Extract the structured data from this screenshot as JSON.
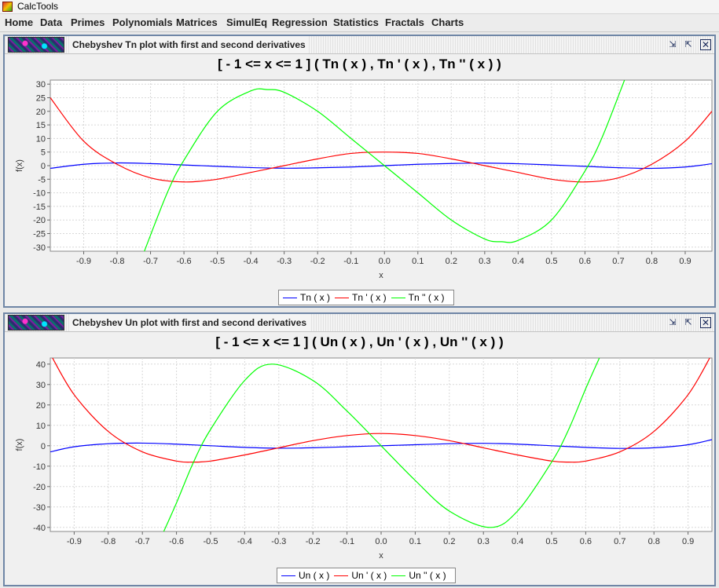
{
  "app": {
    "title": "CalcTools"
  },
  "menu": [
    "Home",
    "Data",
    "Primes",
    "Polynomials",
    "Matrices",
    "SimulEq",
    "Regression",
    "Statistics",
    "Fractals",
    "Charts"
  ],
  "chart_data": [
    {
      "type": "line",
      "window_title": "Chebyshev Tn plot with first and second derivatives",
      "title": "[ - 1 <= x <= 1  ]  ( Tn ( x ) , Tn ' ( x ) , Tn '' ( x ) )",
      "xlabel": "x",
      "ylabel": "f(x)",
      "xlim": [
        -1.0,
        0.98
      ],
      "ylim": [
        -31.5,
        31.5
      ],
      "x_ticks": [
        -0.9,
        -0.8,
        -0.7,
        -0.6,
        -0.5,
        -0.4,
        -0.3,
        -0.2,
        -0.1,
        0.0,
        0.1,
        0.2,
        0.3,
        0.4,
        0.5,
        0.6,
        0.7,
        0.8,
        0.9
      ],
      "y_ticks": [
        30,
        25,
        20,
        15,
        10,
        5,
        0,
        -5,
        -10,
        -15,
        -20,
        -25,
        -30
      ],
      "grid": true,
      "legend_position": "bottom",
      "series": [
        {
          "name": "Tn ( x )",
          "color": "#0000ff",
          "x": [
            -1.0,
            -0.9,
            -0.8,
            -0.7,
            -0.6,
            -0.5,
            -0.4,
            -0.3,
            -0.2,
            -0.1,
            0.0,
            0.1,
            0.2,
            0.3,
            0.4,
            0.5,
            0.6,
            0.7,
            0.8,
            0.9,
            0.98
          ],
          "y": [
            -1.0,
            0.5,
            1.0,
            0.75,
            0.25,
            -0.25,
            -0.7,
            -0.95,
            -0.8,
            -0.5,
            0.0,
            0.5,
            0.8,
            0.95,
            0.7,
            0.25,
            -0.25,
            -0.75,
            -1.0,
            -0.5,
            0.7
          ]
        },
        {
          "name": "Tn ' ( x )",
          "color": "#ff0000",
          "x": [
            -1.0,
            -0.9,
            -0.8,
            -0.7,
            -0.6,
            -0.5,
            -0.4,
            -0.3,
            -0.2,
            -0.1,
            0.0,
            0.1,
            0.2,
            0.3,
            0.4,
            0.5,
            0.6,
            0.7,
            0.8,
            0.9,
            0.98
          ],
          "y": [
            25.0,
            9.0,
            0.5,
            -4.5,
            -6.0,
            -5.0,
            -2.5,
            0.0,
            2.5,
            4.5,
            5.0,
            4.5,
            2.5,
            0.0,
            -2.5,
            -5.0,
            -6.0,
            -4.5,
            0.5,
            9.0,
            20.0
          ]
        },
        {
          "name": "Tn '' ( x )",
          "color": "#00ff00",
          "x": [
            -0.72,
            -0.65,
            -0.6,
            -0.5,
            -0.4,
            -0.35,
            -0.3,
            -0.2,
            -0.1,
            0.0,
            0.1,
            0.2,
            0.3,
            0.35,
            0.4,
            0.5,
            0.6,
            0.65,
            0.72
          ],
          "y": [
            -32.0,
            -10.0,
            2.0,
            20.0,
            27.5,
            28.0,
            27.0,
            20.0,
            10.0,
            0.0,
            -10.0,
            -20.0,
            -27.0,
            -28.0,
            -27.5,
            -20.0,
            -2.0,
            10.0,
            32.0
          ]
        }
      ]
    },
    {
      "type": "line",
      "window_title": "Chebyshev Un plot with first and second derivatives",
      "title": "[ - 1 <= x <= 1  ]  ( Un ( x ) , Un ' ( x ) , Un '' ( x ) )",
      "xlabel": "x",
      "ylabel": "f(x)",
      "xlim": [
        -0.97,
        0.97
      ],
      "ylim": [
        -42,
        43
      ],
      "x_ticks": [
        -0.9,
        -0.8,
        -0.7,
        -0.6,
        -0.5,
        -0.4,
        -0.3,
        -0.2,
        -0.1,
        0.0,
        0.1,
        0.2,
        0.3,
        0.4,
        0.5,
        0.6,
        0.7,
        0.8,
        0.9
      ],
      "y_ticks": [
        40,
        30,
        20,
        10,
        0,
        -10,
        -20,
        -30,
        -40
      ],
      "grid": true,
      "legend_position": "bottom",
      "series": [
        {
          "name": "Un ( x )",
          "color": "#0000ff",
          "x": [
            -0.97,
            -0.9,
            -0.8,
            -0.7,
            -0.6,
            -0.5,
            -0.4,
            -0.3,
            -0.2,
            -0.1,
            0.0,
            0.1,
            0.2,
            0.3,
            0.4,
            0.5,
            0.6,
            0.7,
            0.8,
            0.9,
            0.97
          ],
          "y": [
            -3.0,
            -0.5,
            1.0,
            1.3,
            0.8,
            0.0,
            -0.8,
            -1.2,
            -1.0,
            -0.5,
            0.0,
            0.5,
            1.0,
            1.2,
            0.8,
            0.0,
            -0.8,
            -1.3,
            -1.0,
            0.5,
            3.0
          ]
        },
        {
          "name": "Un ' ( x )",
          "color": "#ff0000",
          "x": [
            -0.97,
            -0.9,
            -0.8,
            -0.7,
            -0.6,
            -0.55,
            -0.5,
            -0.4,
            -0.3,
            -0.2,
            -0.1,
            0.0,
            0.1,
            0.2,
            0.3,
            0.4,
            0.5,
            0.55,
            0.6,
            0.7,
            0.8,
            0.9,
            0.97
          ],
          "y": [
            45.0,
            25.0,
            7.0,
            -3.0,
            -7.5,
            -8.0,
            -7.5,
            -4.5,
            -1.0,
            2.5,
            5.0,
            6.0,
            5.0,
            2.5,
            -1.0,
            -4.5,
            -7.5,
            -8.0,
            -7.5,
            -3.0,
            7.0,
            25.0,
            45.0
          ]
        },
        {
          "name": "Un '' ( x )",
          "color": "#00ff00",
          "x": [
            -0.64,
            -0.6,
            -0.55,
            -0.5,
            -0.4,
            -0.32,
            -0.2,
            -0.1,
            0.0,
            0.1,
            0.2,
            0.32,
            0.4,
            0.5,
            0.55,
            0.6,
            0.64
          ],
          "y": [
            -43.0,
            -28.0,
            -8.0,
            8.0,
            32.0,
            40.0,
            32.0,
            17.0,
            0.0,
            -17.0,
            -32.0,
            -40.0,
            -32.0,
            -8.0,
            8.0,
            28.0,
            43.0
          ]
        }
      ]
    }
  ]
}
